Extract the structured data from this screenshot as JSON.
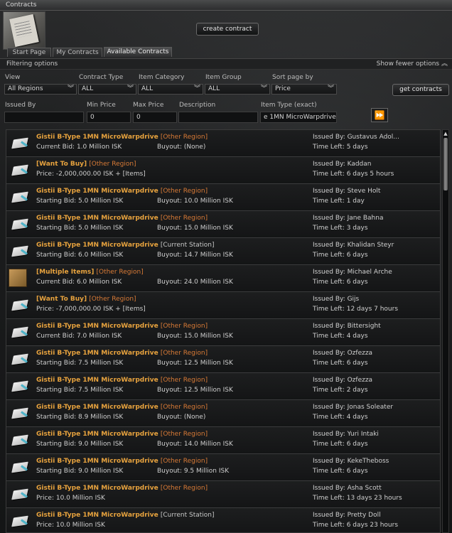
{
  "window": {
    "title": "Contracts"
  },
  "header": {
    "create_label": "create contract"
  },
  "tabs": [
    {
      "label": "Start Page",
      "active": false
    },
    {
      "label": "My Contracts",
      "active": false
    },
    {
      "label": "Available Contracts",
      "active": true
    }
  ],
  "filter_bar": {
    "label": "Filtering options",
    "toggle": "Show fewer options"
  },
  "filters": {
    "view": {
      "label": "View",
      "value": "All Regions"
    },
    "contract_type": {
      "label": "Contract Type",
      "value": "ALL"
    },
    "item_category": {
      "label": "Item Category",
      "value": "ALL"
    },
    "item_group": {
      "label": "Item Group",
      "value": "ALL"
    },
    "sort": {
      "label": "Sort page by",
      "value": "Price"
    },
    "get_label": "get contracts",
    "issued_by": {
      "label": "Issued By",
      "value": ""
    },
    "min_price": {
      "label": "Min Price",
      "value": "0"
    },
    "max_price": {
      "label": "Max Price",
      "value": "0"
    },
    "description": {
      "label": "Description",
      "value": ""
    },
    "item_type": {
      "label": "Item Type (exact)",
      "value": "e 1MN MicroWarpdrive"
    }
  },
  "contracts": [
    {
      "name": "Gistii B-Type 1MN MicroWarpdrive",
      "location": "[Other Region]",
      "location_type": "region",
      "price": "Current Bid: 1.0 Million ISK",
      "buyout": "Buyout: (None)",
      "issuer": "Issued By: Gustavus Adol...",
      "time_left": "Time Left: 5 days",
      "icon": "module"
    },
    {
      "name": "[Want To Buy]",
      "location": "[Other Region]",
      "location_type": "region",
      "price": "Price: -2,000,000.00  ISK + [Items]",
      "buyout": "",
      "issuer": "Issued By: Kaddan",
      "time_left": "Time Left: 6 days 5 hours",
      "icon": "module"
    },
    {
      "name": "Gistii B-Type 1MN MicroWarpdrive",
      "location": "[Other Region]",
      "location_type": "region",
      "price": "Starting Bid: 5.0 Million ISK",
      "buyout": "Buyout: 10.0 Million ISK",
      "issuer": "Issued By: Steve Holt",
      "time_left": "Time Left: 1 day",
      "icon": "module"
    },
    {
      "name": "Gistii B-Type 1MN MicroWarpdrive",
      "location": "[Other Region]",
      "location_type": "region",
      "price": "Starting Bid: 5.0 Million ISK",
      "buyout": "Buyout: 15.0 Million ISK",
      "issuer": "Issued By: Jane Bahna",
      "time_left": "Time Left: 3 days",
      "icon": "module"
    },
    {
      "name": "Gistii B-Type 1MN MicroWarpdrive",
      "location": "[Current Station]",
      "location_type": "station",
      "price": "Starting Bid: 6.0 Million ISK",
      "buyout": "Buyout: 14.7 Million ISK",
      "issuer": "Issued By: Khalidan Steyr",
      "time_left": "Time Left: 6 days",
      "icon": "module"
    },
    {
      "name": "[Multiple Items]",
      "location": "[Other Region]",
      "location_type": "region",
      "price": "Current Bid: 6.0 Million ISK",
      "buyout": "Buyout: 24.0 Million ISK",
      "issuer": "Issued By: Michael Arche",
      "time_left": "Time Left: 6 days",
      "icon": "box"
    },
    {
      "name": "[Want To Buy]",
      "location": "[Other Region]",
      "location_type": "region",
      "price": "Price: -7,000,000.00  ISK + [Items]",
      "buyout": "",
      "issuer": "Issued By: Gijs",
      "time_left": "Time Left: 12 days 7 hours",
      "icon": "module"
    },
    {
      "name": "Gistii B-Type 1MN MicroWarpdrive",
      "location": "[Other Region]",
      "location_type": "region",
      "price": "Current Bid: 7.0 Million ISK",
      "buyout": "Buyout: 15.0 Million ISK",
      "issuer": "Issued By: Bittersight",
      "time_left": "Time Left: 4 days",
      "icon": "module"
    },
    {
      "name": "Gistii B-Type 1MN MicroWarpdrive",
      "location": "[Other Region]",
      "location_type": "region",
      "price": "Starting Bid: 7.5 Million ISK",
      "buyout": "Buyout: 12.5 Million ISK",
      "issuer": "Issued By: Ozfezza",
      "time_left": "Time Left: 6 days",
      "icon": "module"
    },
    {
      "name": "Gistii B-Type 1MN MicroWarpdrive",
      "location": "[Other Region]",
      "location_type": "region",
      "price": "Starting Bid: 7.5 Million ISK",
      "buyout": "Buyout: 12.5 Million ISK",
      "issuer": "Issued By: Ozfezza",
      "time_left": "Time Left: 2 days",
      "icon": "module"
    },
    {
      "name": "Gistii B-Type 1MN MicroWarpdrive",
      "location": "[Other Region]",
      "location_type": "region",
      "price": "Starting Bid: 8.9 Million ISK",
      "buyout": "Buyout: (None)",
      "issuer": "Issued By: Jonas Soleater",
      "time_left": "Time Left: 4 days",
      "icon": "module"
    },
    {
      "name": "Gistii B-Type 1MN MicroWarpdrive",
      "location": "[Other Region]",
      "location_type": "region",
      "price": "Starting Bid: 9.0 Million ISK",
      "buyout": "Buyout: 14.0 Million ISK",
      "issuer": "Issued By: Yuri Intaki",
      "time_left": "Time Left: 6 days",
      "icon": "module"
    },
    {
      "name": "Gistii B-Type 1MN MicroWarpdrive",
      "location": "[Other Region]",
      "location_type": "region",
      "price": "Starting Bid: 9.0 Million ISK",
      "buyout": "Buyout: 9.5 Million ISK",
      "issuer": "Issued By: KekeTheboss",
      "time_left": "Time Left: 6 days",
      "icon": "module"
    },
    {
      "name": "Gistii B-Type 1MN MicroWarpdrive",
      "location": "[Other Region]",
      "location_type": "region",
      "price": "Price: 10.0 Million ISK",
      "buyout": "",
      "issuer": "Issued By: Asha Scott",
      "time_left": "Time Left: 13 days 23 hours",
      "icon": "module"
    },
    {
      "name": "Gistii B-Type 1MN MicroWarpdrive",
      "location": "[Current Station]",
      "location_type": "station",
      "price": "Price: 10.0 Million ISK",
      "buyout": "",
      "issuer": "Issued By: Pretty Doll",
      "time_left": "Time Left: 6 days 23 hours",
      "icon": "module"
    }
  ]
}
